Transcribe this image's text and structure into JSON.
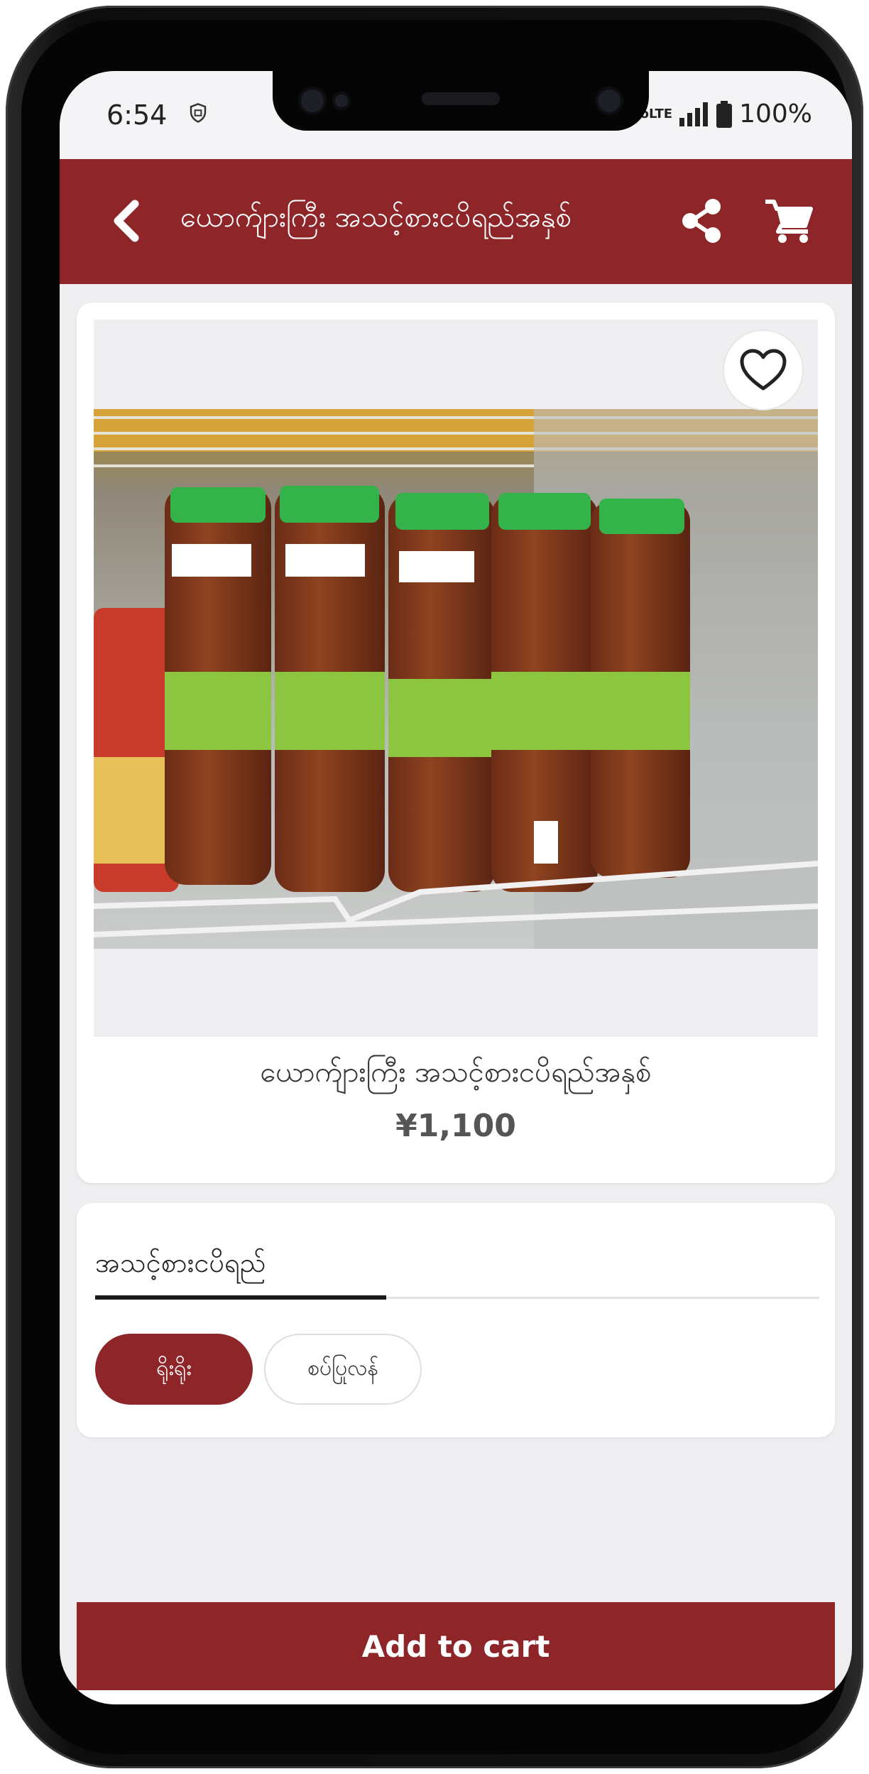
{
  "status_bar": {
    "time": "6:54",
    "network": "VoLTE",
    "battery": "100%"
  },
  "app_bar": {
    "title": "ယောက်ျားကြီး အသင့်စားငပိရည်အနှစ်",
    "back_icon": "chevron-left-icon",
    "share_icon": "share-icon",
    "cart_icon": "cart-icon"
  },
  "product": {
    "name": "ယောက်ျားကြီး အသင့်စားငပိရည်အနှစ်",
    "price": "¥1,100",
    "favorite_icon": "heart-outline-icon",
    "image_alt": "Bottles of fish paste sauce with green caps on a refrigerator shelf"
  },
  "options": {
    "tab_label": "အသင့်စားငပိရည်",
    "choices": [
      {
        "label": "ရိုးရိုး",
        "selected": true
      },
      {
        "label": "စပ်ပြုလန်",
        "selected": false
      }
    ]
  },
  "actions": {
    "add_to_cart": "Add to cart"
  },
  "colors": {
    "brand": "#8e2529",
    "background": "#eeedef",
    "card": "#ffffff"
  }
}
